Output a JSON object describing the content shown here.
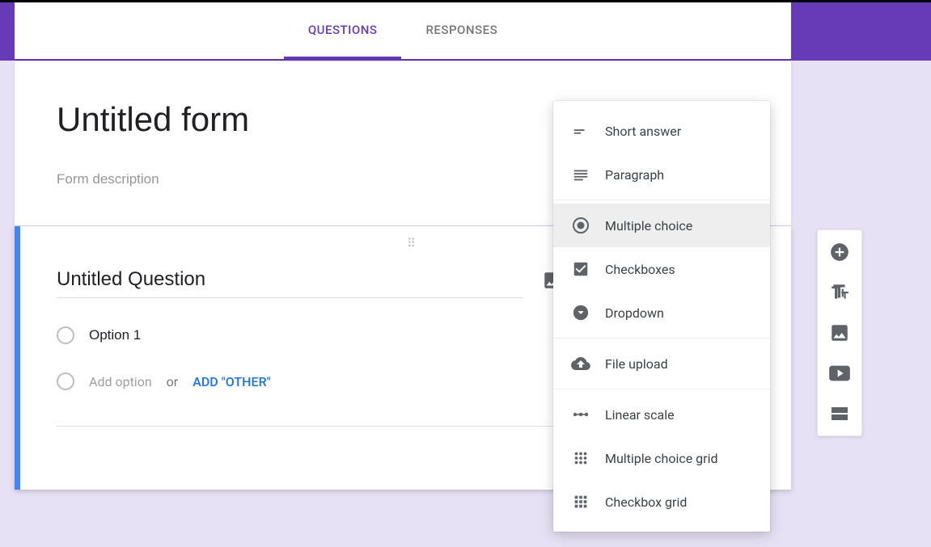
{
  "tabs": {
    "questions": "QUESTIONS",
    "responses": "RESPONSES"
  },
  "form": {
    "title": "Untitled form",
    "description_placeholder": "Form description"
  },
  "question": {
    "text": "Untitled Question",
    "option1": "Option 1",
    "add_option": "Add option",
    "or": "or",
    "add_other": "ADD \"OTHER\""
  },
  "dropdown": {
    "short_answer": "Short answer",
    "paragraph": "Paragraph",
    "multiple_choice": "Multiple choice",
    "checkboxes": "Checkboxes",
    "dropdown": "Dropdown",
    "file_upload": "File upload",
    "linear_scale": "Linear scale",
    "mc_grid": "Multiple choice grid",
    "cb_grid": "Checkbox grid"
  },
  "icons": {
    "add": "add-circle-icon",
    "title": "text-tt-icon",
    "image": "image-icon",
    "video": "video-icon",
    "section": "section-icon"
  }
}
